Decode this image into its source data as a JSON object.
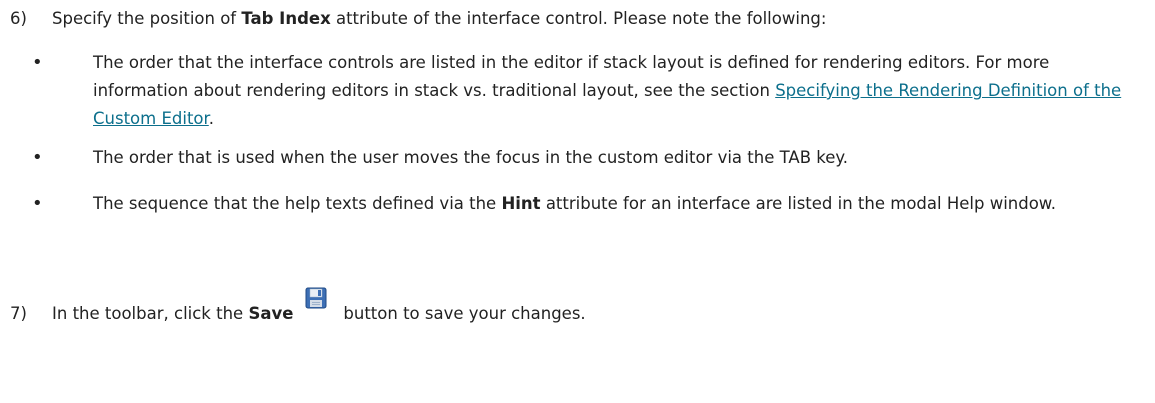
{
  "step6": {
    "number": "6)",
    "text_before": "Specify the position of ",
    "bold": "Tab Index",
    "text_after": " attribute of the interface control. Please note the following:"
  },
  "bullets": {
    "symbol": "•",
    "b1": {
      "text": "The order that the interface controls are listed in the editor if stack layout is defined for rendering editors. For more information about rendering editors in stack vs. traditional layout, see the section ",
      "link": "Specifying the Rendering Definition of the Custom Editor",
      "end": "."
    },
    "b2": {
      "text": "The order that is used when the user moves the focus in the custom editor via the TAB key."
    },
    "b3": {
      "text_before": "The sequence that the help texts defined via the ",
      "bold": "Hint",
      "text_after": " attribute for an interface are listed in the modal Help window."
    }
  },
  "step7": {
    "number": "7)",
    "text_before": "In the toolbar, click the ",
    "bold": "Save",
    "icon": "save-disk-icon",
    "text_after": "button to save your changes."
  },
  "colors": {
    "text": "#222222",
    "link": "#0c6f8c"
  }
}
